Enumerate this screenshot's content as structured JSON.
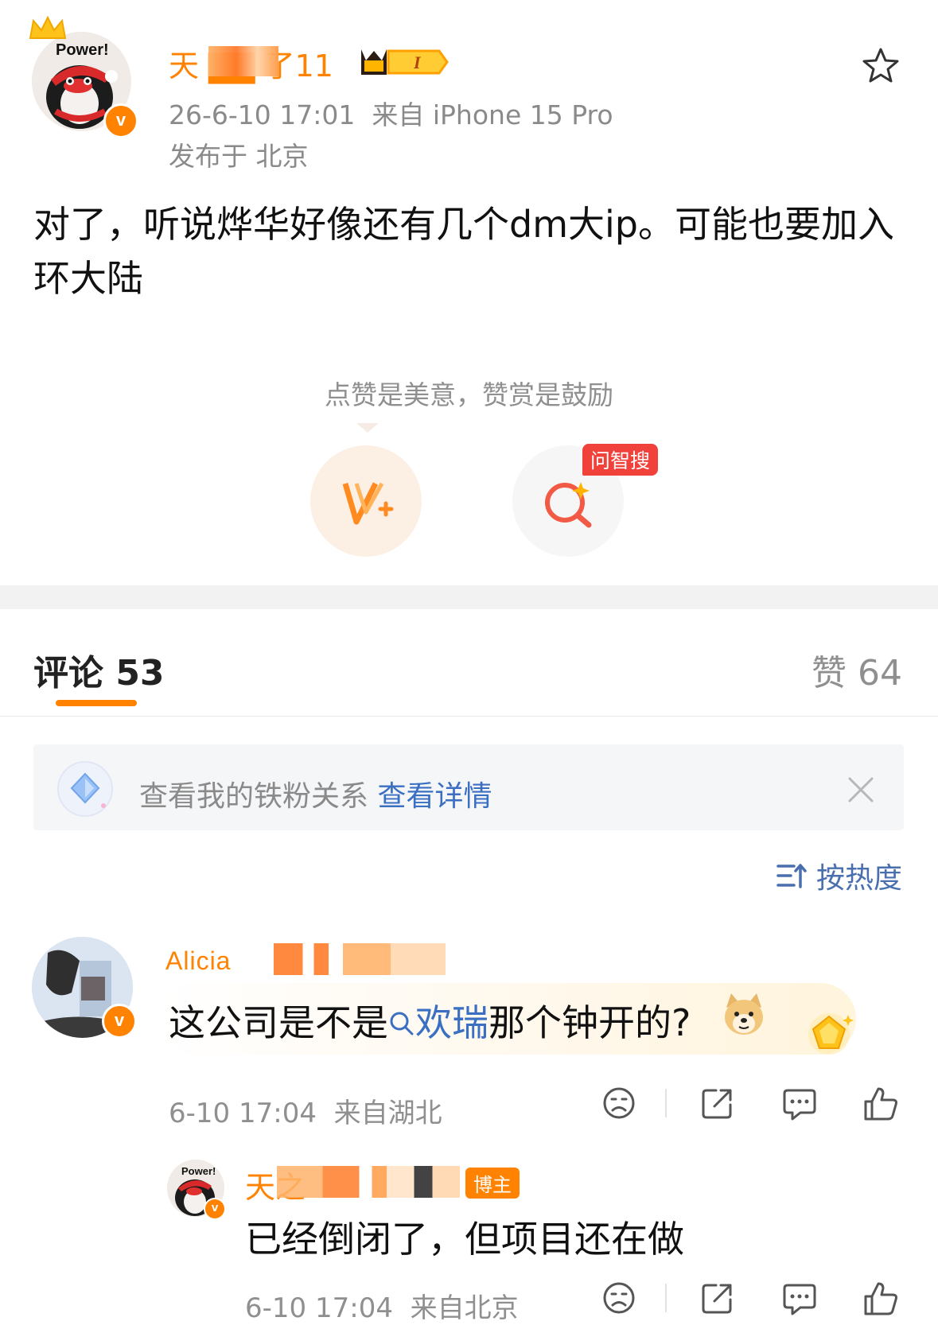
{
  "post": {
    "author_badge_text": "Power!",
    "author_name": "天 ▇▇ 了11",
    "timestamp": "26-6-10 17:01",
    "source": "来自 iPhone 15 Pro",
    "location": "发布于 北京",
    "content": "对了，听说烨华好像还有几个dm大ip。可能也要加入环大陆",
    "vip_level": "I"
  },
  "reward": {
    "tip": "点赞是美意，赞赏是鼓励",
    "search_badge": "问智搜"
  },
  "tabs": {
    "comments_label": "评论 53",
    "likes_label": "赞 64"
  },
  "fans_banner": {
    "text": "查看我的铁粉关系",
    "link": "查看详情"
  },
  "sort": {
    "label": "按热度"
  },
  "comments": [
    {
      "name": "Alicia",
      "text_before": "这公司是不是",
      "highlight": "欢瑞",
      "text_after": "那个钟开的?",
      "time": "6-10 17:04",
      "location": "来自湖北"
    }
  ],
  "reply": {
    "badge_text": "Power!",
    "name": "天之",
    "role_badge": "博主",
    "text": "已经倒闭了，但项目还在做",
    "time": "6-10 17:04",
    "location": "来自北京"
  },
  "colors": {
    "brand_orange": "#ff8200",
    "link_blue": "#3a6fc2",
    "meta_gray": "#8f8f8f"
  }
}
